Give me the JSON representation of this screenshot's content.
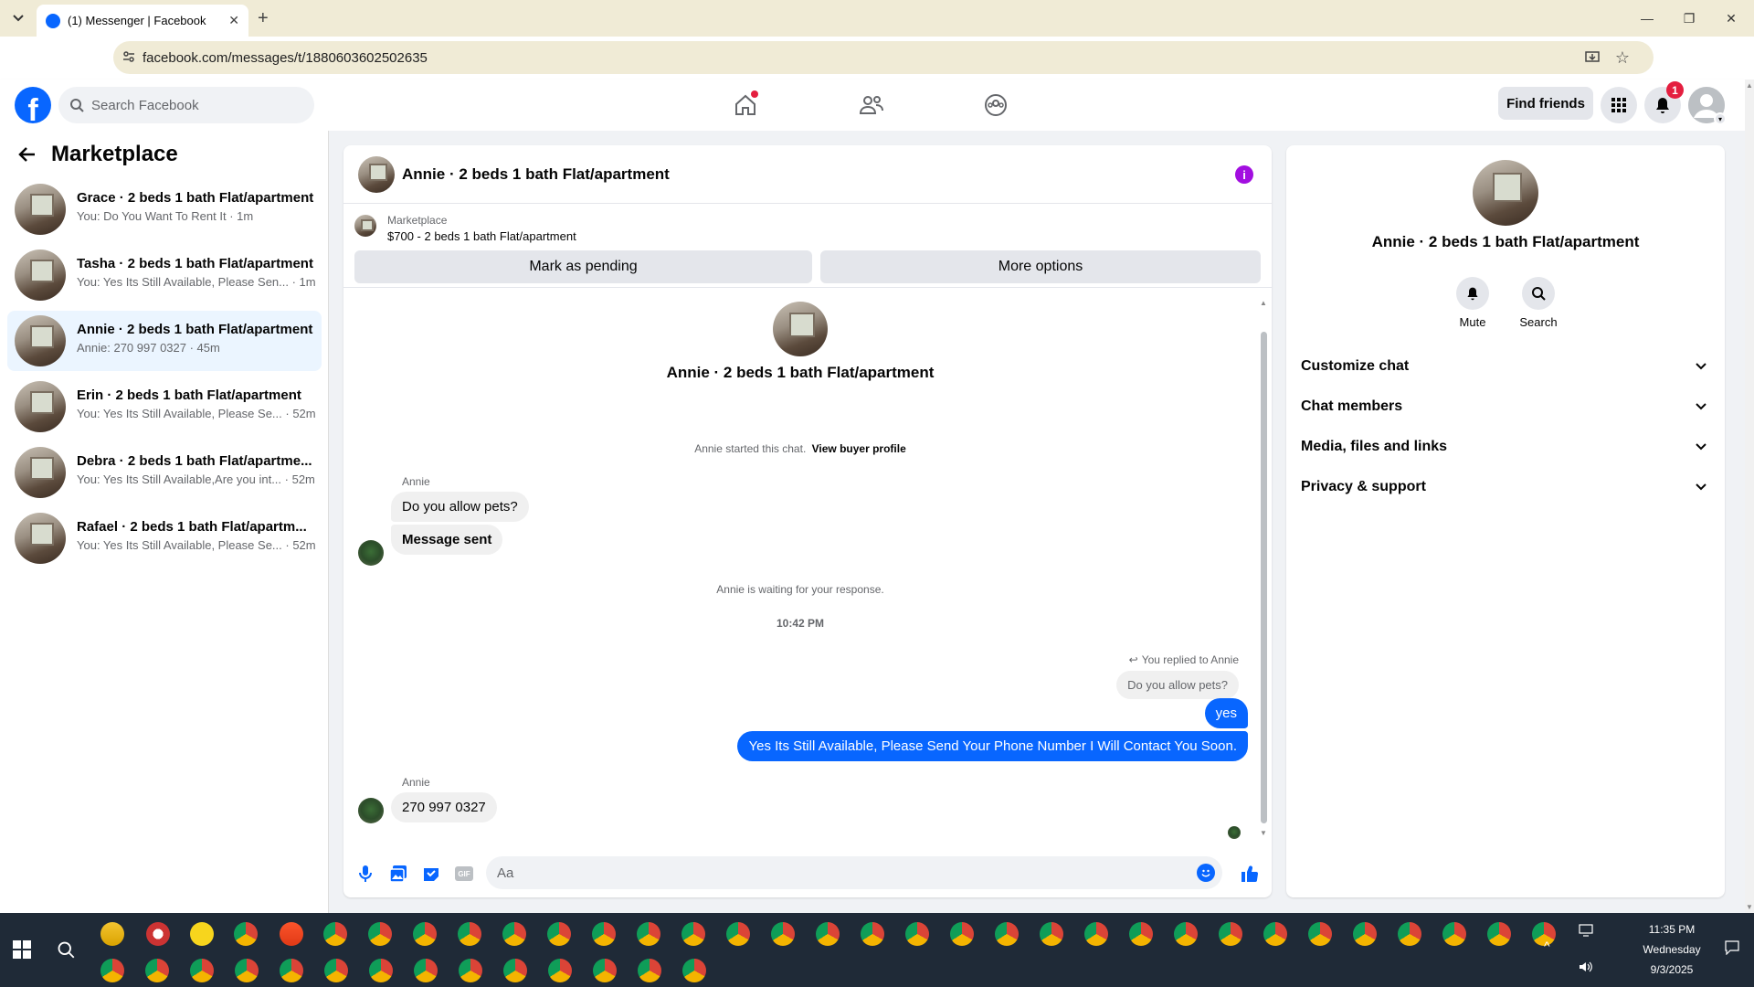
{
  "browser": {
    "tab_title": "(1) Messenger | Facebook",
    "url": "facebook.com/messages/t/1880603602502635"
  },
  "header": {
    "search_placeholder": "Search Facebook",
    "find_friends": "Find friends",
    "notifications_count": "1"
  },
  "sidebar": {
    "title": "Marketplace",
    "conversations": [
      {
        "name": "Grace · 2 beds 1 bath Flat/apartment",
        "preview": "You: Do You Want To Rent It · 1m",
        "active": false
      },
      {
        "name": "Tasha · 2 beds 1 bath Flat/apartment",
        "preview": "You: Yes Its Still Available, Please Sen... · 1m",
        "active": false
      },
      {
        "name": "Annie · 2 beds 1 bath Flat/apartment",
        "preview": "Annie: 270 997 0327 · 45m",
        "active": true
      },
      {
        "name": "Erin · 2 beds 1 bath Flat/apartment",
        "preview": "You: Yes Its Still Available, Please Se... · 52m",
        "active": false
      },
      {
        "name": "Debra · 2 beds 1 bath Flat/apartme...",
        "preview": "You: Yes Its Still Available,Are you int... · 52m",
        "active": false
      },
      {
        "name": "Rafael · 2 beds 1 bath Flat/apartm...",
        "preview": "You: Yes Its Still Available, Please Se... · 52m",
        "active": false
      }
    ]
  },
  "chat": {
    "title": "Annie · 2 beds 1 bath Flat/apartment",
    "marketplace_label": "Marketplace",
    "listing": "$700 - 2 beds 1 bath Flat/apartment",
    "mark_pending": "Mark as pending",
    "more_options": "More options",
    "profile_name": "Annie · 2 beds 1 bath Flat/apartment",
    "started_text": "Annie started this chat.",
    "view_buyer": "View buyer profile",
    "sender_1": "Annie",
    "msg_1": "Do you allow pets?",
    "msg_2": "Message sent",
    "waiting": "Annie is waiting for your response.",
    "time": "10:42 PM",
    "replied_to": "You replied to Annie",
    "quoted": "Do you allow pets?",
    "reply_1": "yes",
    "reply_2": "Yes Its Still Available, Please Send Your Phone Number I Will Contact You Soon.",
    "sender_2": "Annie",
    "msg_3": "270 997 0327",
    "input_placeholder": "Aa"
  },
  "right_panel": {
    "name": "Annie · 2 beds 1 bath Flat/apartment",
    "mute": "Mute",
    "search": "Search",
    "sections": [
      "Customize chat",
      "Chat members",
      "Media, files and links",
      "Privacy & support"
    ]
  },
  "taskbar": {
    "time": "11:35 PM",
    "day": "Wednesday",
    "date": "9/3/2025"
  },
  "colors": {
    "fb_blue": "#0866ff",
    "purple_info": "#a20ee0",
    "notif_red": "#e41e3f"
  }
}
